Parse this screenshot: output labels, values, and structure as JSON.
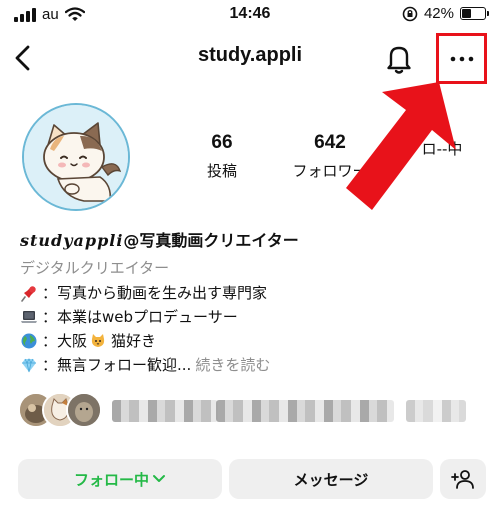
{
  "status_bar": {
    "carrier": "au",
    "time": "14:46",
    "battery_percent": "42%",
    "battery_level": 0.42,
    "icons": [
      "signal-icon",
      "wifi-icon",
      "orientation-lock-icon",
      "battery-icon"
    ]
  },
  "header": {
    "username": "study.appli",
    "icons": [
      "back-chevron-icon",
      "bell-icon",
      "more-dots-icon"
    ],
    "highlight_color": "#e8121a"
  },
  "profile": {
    "stats": [
      {
        "value": "66",
        "label": "投稿"
      },
      {
        "value": "642",
        "label": "フォロワー"
      },
      {
        "value": "",
        "label": "ロ--中"
      }
    ],
    "name_script": "studyappli",
    "name_suffix": "@写真動画クリエイター",
    "category": "デジタルクリエイター",
    "bio_lines": [
      {
        "icon": "pushpin-icon",
        "text": "：写真から動画を生み出す専門家"
      },
      {
        "icon": "laptop-icon",
        "text": "：本業はwebプロデューサー"
      },
      {
        "icon": "globe-icon",
        "text": "：大阪 ",
        "extra_icon": "cat-icon",
        "extra_text": " 猫好き"
      },
      {
        "icon": "gem-icon",
        "text": "：無言フォロー歓迎...",
        "more": "続きを読む"
      }
    ]
  },
  "actions": {
    "follow_label": "フォロー中",
    "message_label": "メッセージ",
    "follow_color": "#24b947",
    "icons": [
      "chevron-down-icon",
      "add-person-icon"
    ]
  }
}
